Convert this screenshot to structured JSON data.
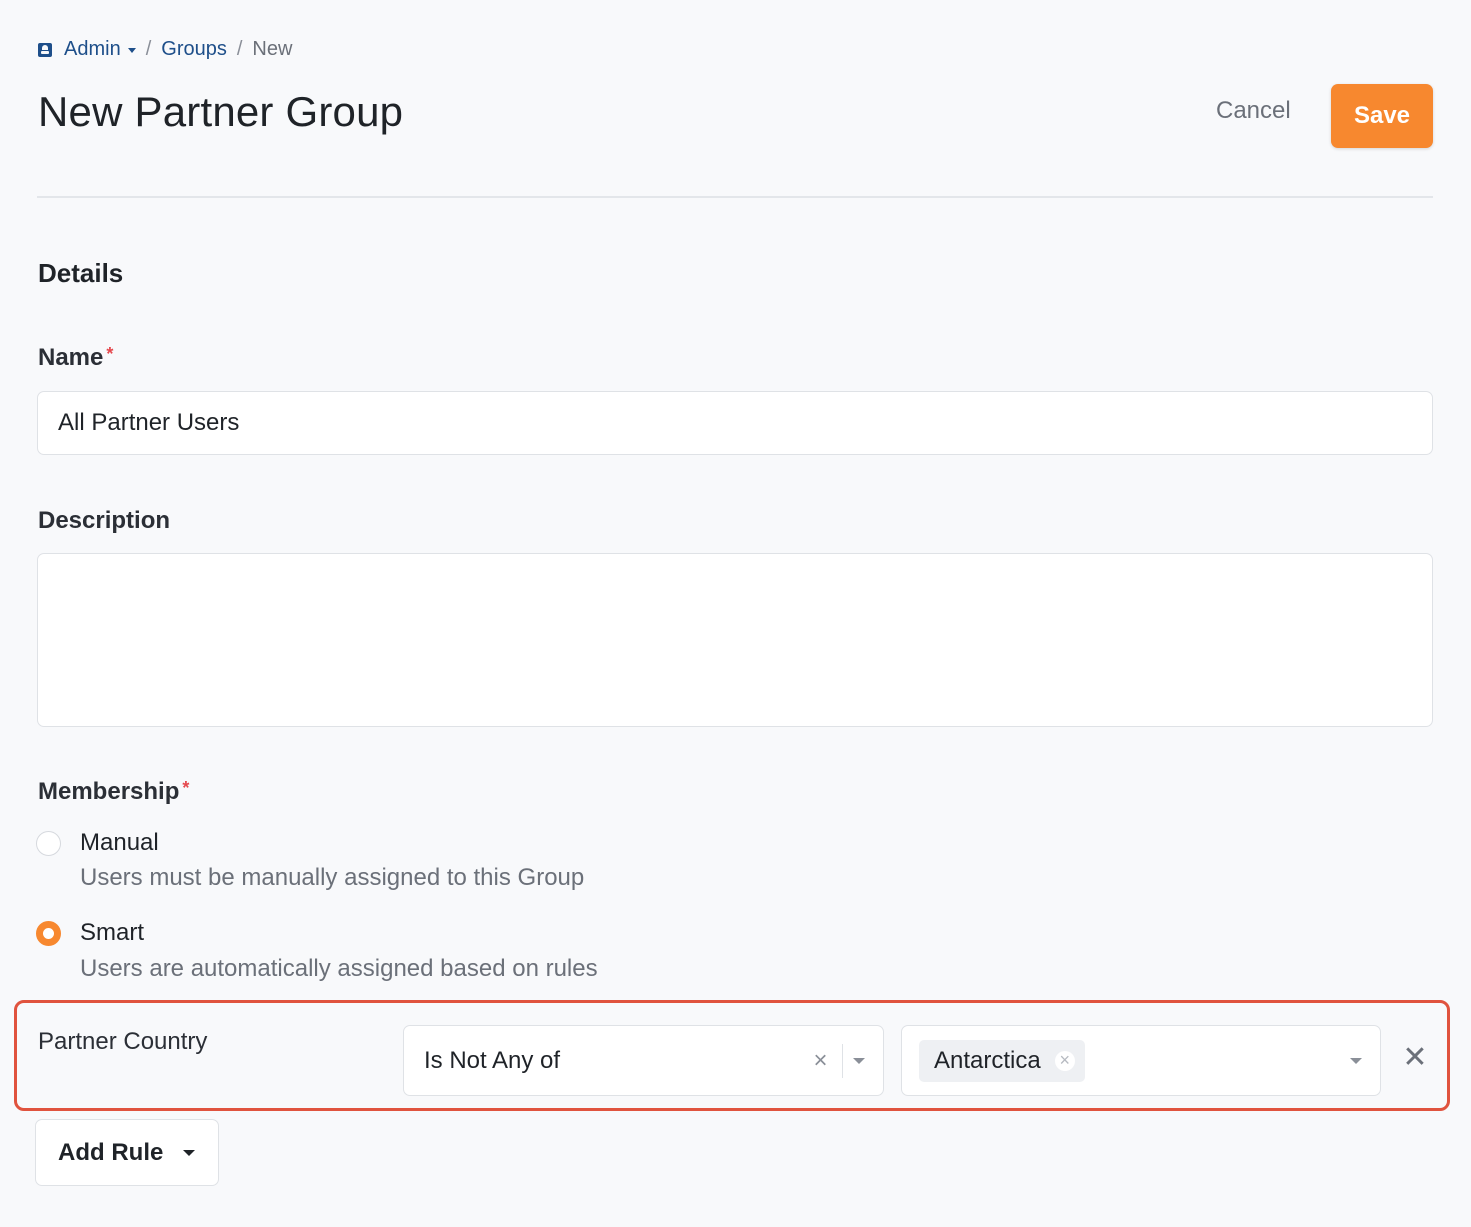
{
  "breadcrumb": {
    "admin": "Admin",
    "groups": "Groups",
    "current": "New",
    "sep": "/"
  },
  "header": {
    "title": "New Partner Group",
    "cancel": "Cancel",
    "save": "Save"
  },
  "details": {
    "section_title": "Details",
    "name_label": "Name",
    "name_value": "All Partner Users",
    "description_label": "Description",
    "description_value": "",
    "required_mark": "*"
  },
  "membership": {
    "label": "Membership",
    "options": [
      {
        "label": "Manual",
        "help": "Users must be manually assigned to this Group",
        "checked": false
      },
      {
        "label": "Smart",
        "help": "Users are automatically assigned based on rules",
        "checked": true
      }
    ]
  },
  "rule": {
    "field": "Partner Country",
    "operator": "Is Not Any of",
    "values": [
      "Antarctica"
    ],
    "clear_icon": "×",
    "remove_icon": "✕"
  },
  "add_rule": {
    "label": "Add Rule"
  },
  "colors": {
    "accent": "#f7882f",
    "link": "#1e4f8a",
    "highlight": "#e0533e"
  }
}
